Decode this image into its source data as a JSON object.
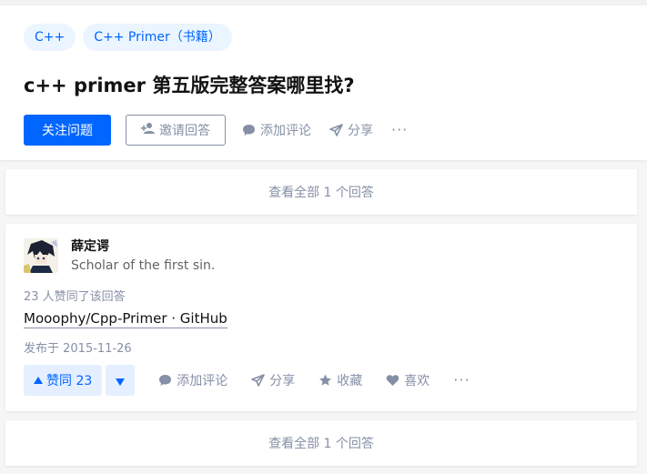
{
  "question": {
    "topics": [
      "C++",
      "C++ Primer（书籍）"
    ],
    "title": "c++ primer 第五版完整答案哪里找?",
    "actions": {
      "follow_label": "关注问题",
      "invite_label": "邀请回答",
      "comment_label": "添加评论",
      "share_label": "分享",
      "more_label": "···"
    }
  },
  "view_all_top": {
    "label": "查看全部 1 个回答"
  },
  "answer": {
    "author": {
      "name": "薛定谔",
      "headline": "Scholar of the first sin."
    },
    "vote_summary": "23 人赞同了该回答",
    "link_text": "Mooophy/Cpp-Primer · GitHub",
    "published": "发布于 2015-11-26",
    "actions": {
      "upvote_label": "赞同 23",
      "comment_label": "添加评论",
      "share_label": "分享",
      "collect_label": "收藏",
      "like_label": "喜欢",
      "more_label": "···"
    }
  },
  "view_all_bottom": {
    "label": "查看全部 1 个回答"
  },
  "colors": {
    "brand_blue": "#0066ff",
    "tag_bg": "#ebf5ff",
    "vote_bg": "#e5efff",
    "muted_gray": "#8590a6",
    "page_bg": "#f6f6f6"
  }
}
